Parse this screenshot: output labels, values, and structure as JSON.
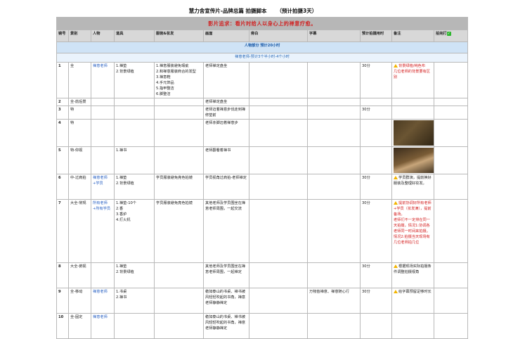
{
  "doc": {
    "title": "慧力舍宣传片-品牌总篇 拍摄脚本",
    "subtitle": "（预计拍摄3天）"
  },
  "banner": "影片追求：看片时给人以身心上的禅意疗愈。",
  "headers": [
    "镜号",
    "景别",
    "人物",
    "道具",
    "服装&妆发",
    "画面",
    "旁白",
    "字幕",
    "预计拍摄用时",
    "备注",
    "拍完打"
  ],
  "check_icon": "check-box-icon",
  "section": "人物部分 预计20小时",
  "subsection": "禅意老师-预计3个半小时-4个小时",
  "rows": [
    {
      "no": "1",
      "shot": "全",
      "person": "禅意老师",
      "props": "1.禅垫\n2.背景绿植",
      "costume": "1.禅意服装避免瑕疵\n2.和禅意服装商合的发型\n3.禅意鞋\n4.手元饰品\n5.指甲整洁\n6.脚整洁",
      "scene": "老师禅定盘坐",
      "vo": "",
      "sub": "",
      "time": "30分",
      "note": "背景绿植/纯色布\n几位老师的背景要有区别"
    },
    {
      "no": "2",
      "shot": "全-前后景",
      "person": "",
      "props": "",
      "costume": "",
      "scene": "老师禅定盘坐",
      "vo": "",
      "sub": "",
      "time": "",
      "note": ""
    },
    {
      "no": "3",
      "shot": "特",
      "person": "",
      "props": "",
      "costume": "",
      "scene": "老师迈着禅意步伐走到禅修垫前",
      "vo": "",
      "sub": "",
      "time": "30分",
      "note": ""
    },
    {
      "no": "4",
      "shot": "特",
      "person": "",
      "props": "",
      "costume": "",
      "scene": "老师赤脚迈着禅意步",
      "vo": "",
      "sub": "",
      "time": "",
      "note": ""
    },
    {
      "no": "5",
      "shot": "特-仰视",
      "person": "",
      "props": "1.禅书",
      "costume": "",
      "scene": "老师翻看着禅书",
      "vo": "",
      "sub": "",
      "time": "",
      "note": ""
    },
    {
      "no": "6",
      "shot": "中-过肩拍",
      "person": "禅意老师+学员",
      "props": "1.禅垫\n2.背景绿植",
      "costume": "学员服装避免亮色拍镜",
      "scene": "学员视角过肩拍-老师禅定",
      "vo": "",
      "sub": "",
      "time": "30分",
      "note": "学员群演，提前换好服装及整理好妆发。"
    },
    {
      "no": "7",
      "shot": "大全-常规",
      "person": "所有老师+所有学员",
      "props": "1.禅垫-10个\n2.香\n3.香炉\n4.打火机",
      "costume": "学员服装避免亮色拍镜",
      "scene": "其他老师及学员围坐在禅意老师周围，一起交流",
      "vo": "",
      "sub": "",
      "time": "30分",
      "note": "提前协调好所有老师+学员（妆发满），提前备场。\n老师们不一定排在同一天拍摄，情况1:协调各老师同一时间来拍摄。情况2:拍摄当天现场有几位老师拍几位"
    },
    {
      "no": "8",
      "shot": "大全-俯视",
      "person": "",
      "props": "1.禅垫\n2.背景绿植",
      "costume": "",
      "scene": "其他老师及学员围坐在禅意老师周围，一起禅定",
      "vo": "",
      "sub": "",
      "time": "30分",
      "note": "根据现场实际拍摄条件调整拍摄视角"
    },
    {
      "no": "9",
      "shot": "全-移动",
      "person": "禅意老师",
      "props": "1.书桌\n2.禅书",
      "costume": "",
      "scene": "稳如泰山的书桌、禅书被风轻轻吹起的书角，禅意老师静静禅定",
      "vo": "",
      "sub": "万物皆禅意、禅意随心行",
      "time": "30分",
      "note": "给字幕预留足够时长"
    },
    {
      "no": "10",
      "shot": "全-固定",
      "person": "禅意老师",
      "props": "",
      "costume": "",
      "scene": "稳如泰山的书桌、禅书被风轻轻吹起的书角，禅意老师静静禅定",
      "vo": "",
      "sub": "",
      "time": "",
      "note": ""
    }
  ],
  "icons": {
    "warning": "warning-icon"
  }
}
